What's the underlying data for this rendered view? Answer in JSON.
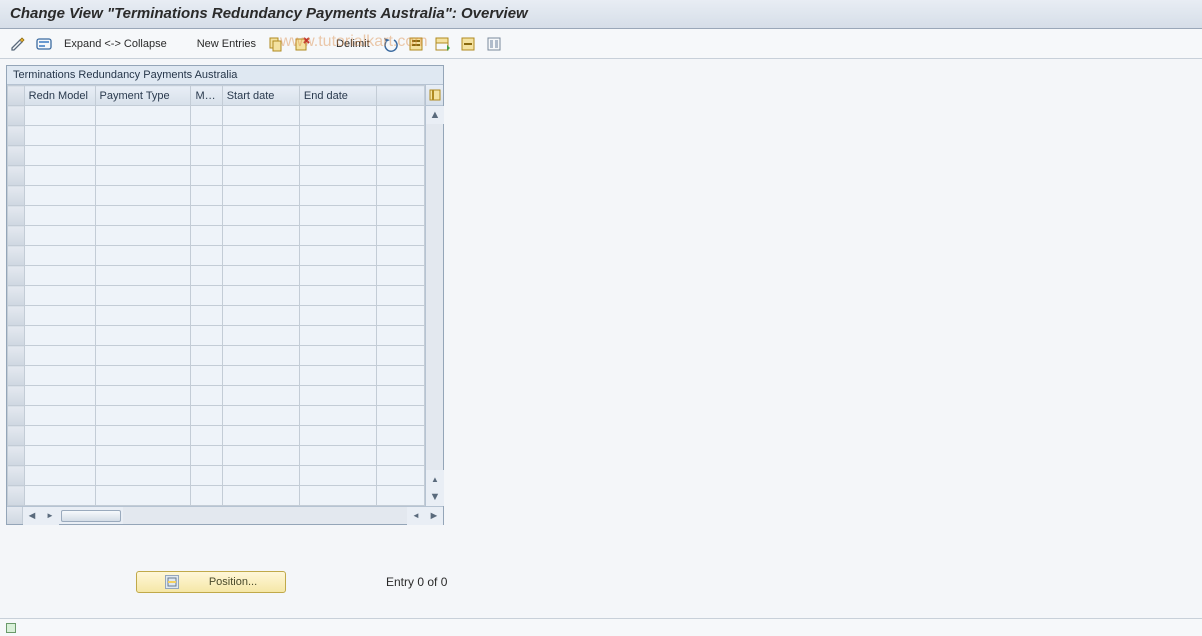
{
  "title": "Change View \"Terminations Redundancy Payments Australia\": Overview",
  "toolbar": {
    "expand_label": "Expand <-> Collapse",
    "new_entries_label": "New Entries",
    "delimit_label": "Delimit"
  },
  "watermark": "www.tutorialkart.com",
  "panel": {
    "header": "Terminations Redundancy Payments Australia",
    "columns": {
      "redn_model": "Redn Model",
      "payment_type": "Payment Type",
      "ma": "Ma...",
      "start_date": "Start date",
      "end_date": "End date"
    },
    "row_count": 20
  },
  "footer": {
    "position_label": "Position...",
    "entry_text": "Entry 0 of 0"
  },
  "statusbar": {
    "message": ""
  }
}
